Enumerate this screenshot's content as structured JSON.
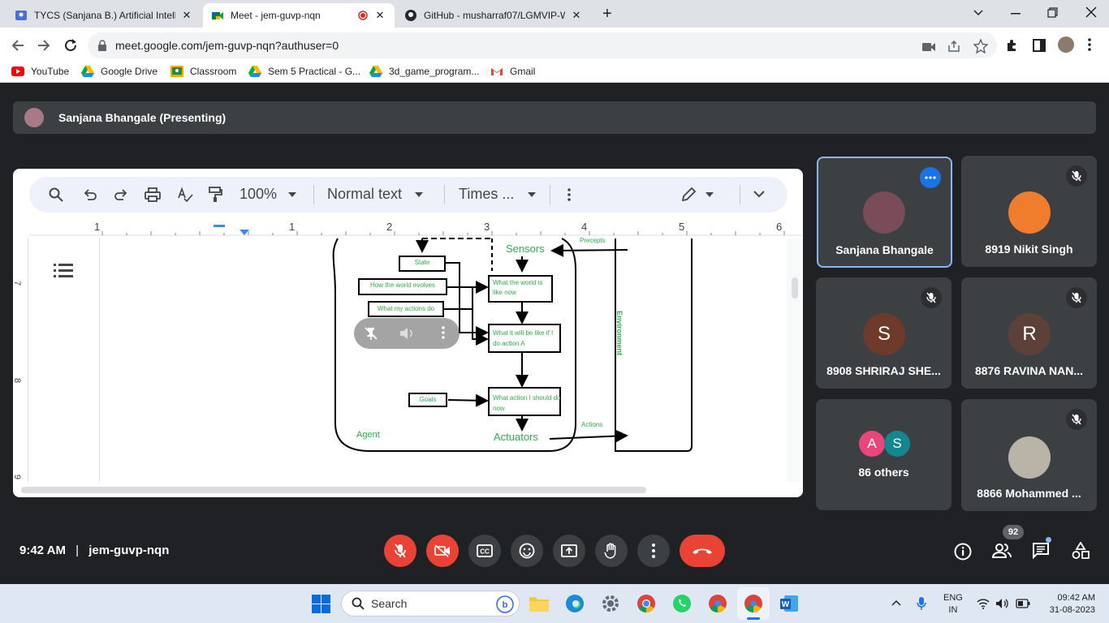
{
  "browser": {
    "tabs": [
      {
        "title": "TYCS (Sanjana B.) Artificial Intellig",
        "close": "✕"
      },
      {
        "title": "Meet - jem-guvp-nqn",
        "close": "✕"
      },
      {
        "title": "GitHub - musharraf07/LGMVIP-W",
        "close": "✕"
      }
    ],
    "new_tab": "+",
    "url": "meet.google.com/jem-guvp-nqn?authuser=0",
    "bookmarks": [
      "YouTube",
      "Google Drive",
      "Classroom",
      "Sem 5 Practical - G...",
      "3d_game_program...",
      "Gmail"
    ]
  },
  "meet": {
    "presenter": "Sanjana Bhangale (Presenting)",
    "doc_toolbar": {
      "zoom": "100%",
      "style": "Normal text",
      "font": "Times ..."
    },
    "ruler": [
      "1",
      "1",
      "2",
      "3",
      "4",
      "5",
      "6"
    ],
    "vruler": [
      "7",
      "8",
      "9"
    ],
    "diagram": {
      "state": "State",
      "evolves": "How the world evolves",
      "actions_do": "What my actions do",
      "world_now": "What the world is like now",
      "will_be": "What it will be like if I do action A",
      "goals": "Goals",
      "should_do": "What action I should do now",
      "sensors": "Sensors",
      "actuators": "Actuators",
      "agent": "Agent",
      "environment": "Environment",
      "precepts": "Precepts",
      "actions": "Actions"
    },
    "participants": [
      {
        "name": "Sanjana Bhangale"
      },
      {
        "name": "8919 Nikit Singh"
      },
      {
        "name": "8908 SHRIRAJ SHE...",
        "initial": "S",
        "color": "#6e3b2a"
      },
      {
        "name": "8876 RAVINA NAN...",
        "initial": "R",
        "color": "#5d4037"
      },
      {
        "name": "86 others",
        "initials": [
          "A",
          "S"
        ],
        "colors": [
          "#e8467c",
          "#12878f"
        ]
      },
      {
        "name": "8866 Mohammed ..."
      }
    ],
    "time": "9:42 AM",
    "separator": "|",
    "meeting_code": "jem-guvp-nqn",
    "people_count": "92"
  },
  "taskbar": {
    "search": "Search",
    "lang": "ENG",
    "region": "IN",
    "clock": "09:42 AM",
    "date": "31-08-2023"
  },
  "colors": {
    "end_call": "#ea4335",
    "highlight": "#8ab4f8",
    "diagram_green": "#2bb04a"
  }
}
